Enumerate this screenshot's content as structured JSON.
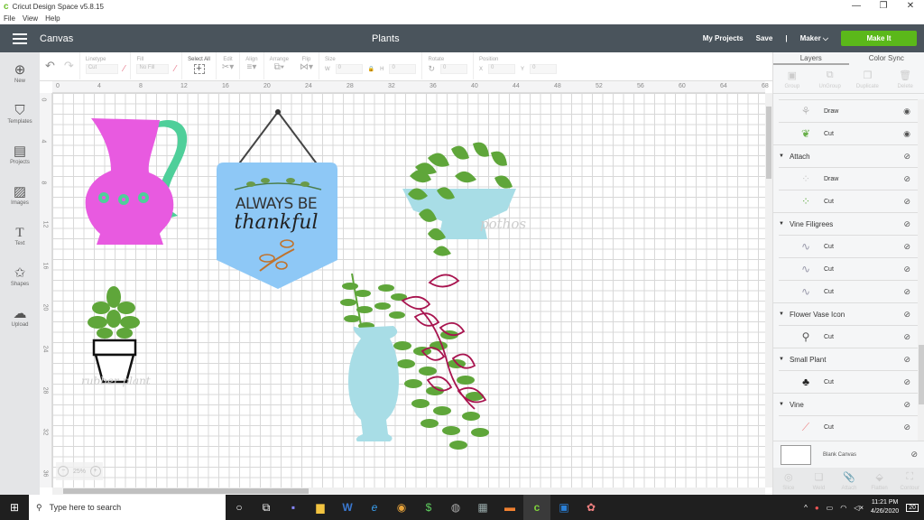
{
  "window": {
    "app_title": "Cricut Design Space  v5.8.15",
    "controls": [
      "—",
      "❐",
      "✕"
    ]
  },
  "menu": [
    "File",
    "View",
    "Help"
  ],
  "header": {
    "section": "Canvas",
    "project_title": "Plants",
    "my_projects": "My Projects",
    "save": "Save",
    "separator": "|",
    "machine": "Maker",
    "make_it": "Make It",
    "make_it_color": "#5bb81a"
  },
  "leftbar": [
    {
      "label": "New",
      "icon": "plus-circle-icon",
      "glyph": "⊕"
    },
    {
      "label": "Templates",
      "icon": "tshirt-icon",
      "glyph": "👕"
    },
    {
      "label": "Projects",
      "icon": "notebook-icon",
      "glyph": "📓"
    },
    {
      "label": "Images",
      "icon": "image-icon",
      "glyph": "🖼"
    },
    {
      "label": "Text",
      "icon": "text-icon",
      "glyph": "T"
    },
    {
      "label": "Shapes",
      "icon": "shapes-icon",
      "glyph": "✩"
    },
    {
      "label": "Upload",
      "icon": "upload-cloud-icon",
      "glyph": "☁"
    }
  ],
  "toolbar": {
    "undo": "↶",
    "redo": "↷",
    "linetype_label": "Linetype",
    "linetype_value": "Cut",
    "fill_label": "Fill",
    "fill_value": "No Fill",
    "select_all": "Select All",
    "edit": "Edit",
    "align": "Align",
    "arrange": "Arrange",
    "flip": "Flip",
    "size": "Size",
    "w_label": "W",
    "w_value": "0",
    "h_label": "H",
    "h_value": "0",
    "rotate": "Rotate",
    "rotate_value": "0",
    "position": "Position",
    "x_label": "X",
    "x_value": "0",
    "y_label": "Y",
    "y_value": "0"
  },
  "rulers": {
    "top": [
      "0",
      "4",
      "8",
      "12",
      "16",
      "20",
      "24",
      "28",
      "32",
      "36",
      "40",
      "44",
      "48",
      "52",
      "56",
      "60",
      "64",
      "68"
    ],
    "left": [
      "0",
      "4",
      "8",
      "12",
      "16",
      "20",
      "24",
      "28",
      "32",
      "36"
    ]
  },
  "canvas": {
    "zoom": "25%",
    "sign_line1": "ALWAYS BE",
    "sign_line2": "thankful",
    "pothos_label": "pothos",
    "rubber_label": "rubber plant"
  },
  "panel": {
    "tabs": [
      "Layers",
      "Color Sync"
    ],
    "actions": [
      "Group",
      "UnGroup",
      "Duplicate",
      "Delete"
    ],
    "layers": [
      {
        "type": "item",
        "label": "Draw",
        "thumb": "⚘",
        "color": "#bbbbbb",
        "eye": "visible"
      },
      {
        "type": "item",
        "label": "Cut",
        "thumb": "❦",
        "color": "#6ab04c",
        "eye": "visible"
      },
      {
        "type": "group",
        "label": "Attach",
        "eye": "hidden"
      },
      {
        "type": "item",
        "label": "Draw",
        "thumb": "⁘",
        "color": "#cccccc",
        "eye": "hidden"
      },
      {
        "type": "item",
        "label": "Cut",
        "thumb": "⁘",
        "color": "#6ab04c",
        "eye": "hidden"
      },
      {
        "type": "group",
        "label": "Vine Filigrees",
        "eye": "hidden"
      },
      {
        "type": "item",
        "label": "Cut",
        "thumb": "∿",
        "color": "#99a",
        "eye": "hidden"
      },
      {
        "type": "item",
        "label": "Cut",
        "thumb": "∿",
        "color": "#99a",
        "eye": "hidden"
      },
      {
        "type": "item",
        "label": "Cut",
        "thumb": "∿",
        "color": "#99a",
        "eye": "hidden"
      },
      {
        "type": "group",
        "label": "Flower Vase Icon",
        "eye": "hidden"
      },
      {
        "type": "item",
        "label": "Cut",
        "thumb": "⚲",
        "color": "#555",
        "eye": "hidden"
      },
      {
        "type": "group",
        "label": "Small Plant",
        "eye": "hidden"
      },
      {
        "type": "item",
        "label": "Cut",
        "thumb": "♣",
        "color": "#222",
        "eye": "hidden"
      },
      {
        "type": "group",
        "label": "Vine",
        "eye": "hidden"
      },
      {
        "type": "item",
        "label": "Cut",
        "thumb": "⟋",
        "color": "#e88",
        "eye": "hidden"
      }
    ],
    "blank_canvas": "Blank Canvas",
    "bottom_actions": [
      "Slice",
      "Weld",
      "Attach",
      "Flatten",
      "Contour"
    ]
  },
  "taskbar": {
    "search_placeholder": "Type here to search",
    "time": "11:21 PM",
    "date": "4/26/2020",
    "notifications": "20"
  }
}
